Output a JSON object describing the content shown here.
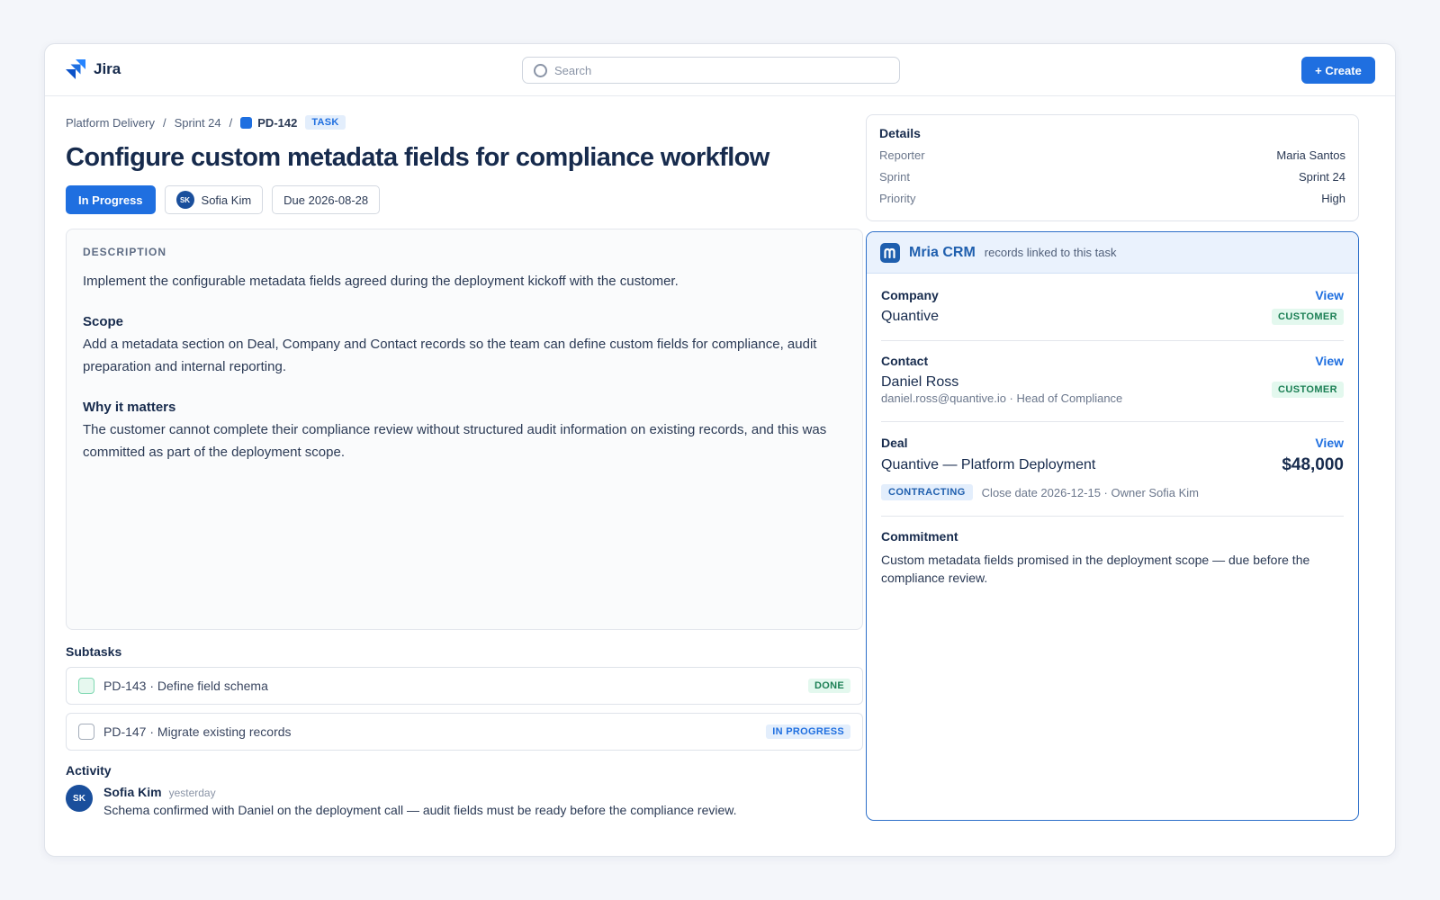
{
  "app": {
    "name": "Jira"
  },
  "search": {
    "placeholder": "Search"
  },
  "toolbar": {
    "create_label": "+ Create"
  },
  "breadcrumb": {
    "project": "Platform Delivery",
    "sprint": "Sprint 24",
    "separator": "/",
    "issue_key": "PD-142",
    "type_badge": "TASK"
  },
  "issue": {
    "title": "Configure custom metadata fields for compliance workflow",
    "status": "In Progress",
    "assignee": {
      "initials": "SK",
      "name": "Sofia Kim"
    },
    "due": "Due 2026-08-28"
  },
  "description": {
    "label": "DESCRIPTION",
    "intro": "Implement the configurable metadata fields agreed during the deployment kickoff with the customer.",
    "scope_heading": "Scope",
    "scope_text": "Add a metadata section on Deal, Company and Contact records so the team can define custom fields for compliance, audit preparation and internal reporting.",
    "why_heading": "Why it matters",
    "why_text": "The customer cannot complete their compliance review without structured audit information on existing records, and this was committed as part of the deployment scope."
  },
  "subtasks": {
    "title": "Subtasks",
    "items": [
      {
        "label": "PD-143 · Define field schema",
        "status": "DONE"
      },
      {
        "label": "PD-147 · Migrate existing records",
        "status": "IN PROGRESS"
      }
    ]
  },
  "activity": {
    "title": "Activity",
    "comments": [
      {
        "initials": "SK",
        "author": "Sofia Kim",
        "time": "yesterday",
        "text": "Schema confirmed with Daniel on the deployment call — audit fields must be ready before the compliance review."
      }
    ]
  },
  "details": {
    "title": "Details",
    "rows": [
      {
        "label": "Reporter",
        "value": "Maria Santos"
      },
      {
        "label": "Sprint",
        "value": "Sprint 24"
      },
      {
        "label": "Priority",
        "value": "High"
      }
    ]
  },
  "crm": {
    "name": "Mria CRM",
    "subtitle": "records linked to this task",
    "view_label": "View",
    "company": {
      "label": "Company",
      "name": "Quantive",
      "badge": "CUSTOMER"
    },
    "contact": {
      "label": "Contact",
      "name": "Daniel Ross",
      "detail": "daniel.ross@quantive.io · Head of Compliance",
      "badge": "CUSTOMER"
    },
    "deal": {
      "label": "Deal",
      "name": "Quantive — Platform Deployment",
      "amount": "$48,000",
      "stage": "CONTRACTING",
      "meta": "Close date 2026-12-15 · Owner Sofia Kim"
    },
    "commitment": {
      "label": "Commitment",
      "text": "Custom metadata fields promised in the deployment scope — due before the compliance review."
    }
  },
  "colors": {
    "accent": "#1f6fe0",
    "crm_brand": "#1f5fae",
    "success": "#1b7f54"
  }
}
